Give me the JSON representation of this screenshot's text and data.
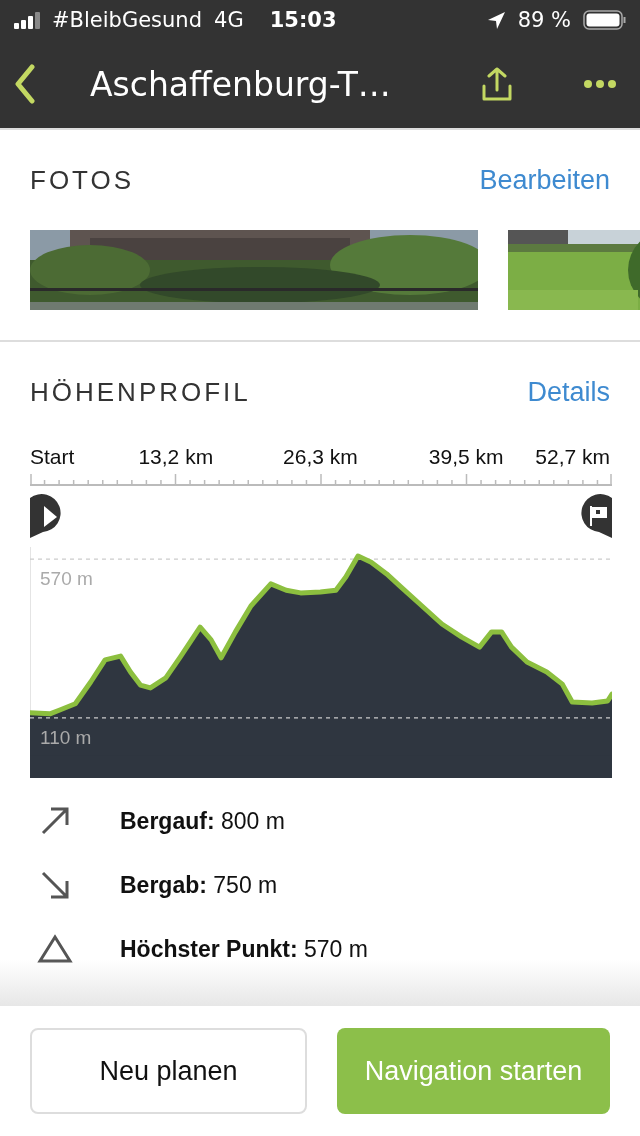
{
  "status_bar": {
    "carrier": "#BleibGesund",
    "network": "4G",
    "time": "15:03",
    "battery": "89 %"
  },
  "nav_bar": {
    "title": "Aschaffenburg-T…"
  },
  "photos": {
    "title": "FOTOS",
    "action": "Bearbeiten"
  },
  "elevation": {
    "title": "HÖHENPROFIL",
    "action": "Details",
    "chart_data": {
      "type": "area",
      "xlim": [
        0,
        52.7
      ],
      "ylim": [
        -64,
        605
      ],
      "xticks": [
        {
          "value": 0,
          "label": "Start"
        },
        {
          "value": 13.2,
          "label": "13,2 km"
        },
        {
          "value": 26.3,
          "label": "26,3 km"
        },
        {
          "value": 39.5,
          "label": "39,5 km"
        },
        {
          "value": 52.7,
          "label": "52,7 km"
        }
      ],
      "yticks": [
        {
          "value": 570,
          "label": "570 m"
        },
        {
          "value": 110,
          "label": "110 m"
        }
      ],
      "x": [
        0,
        1.8,
        2.7,
        4.1,
        5.5,
        6.8,
        8.2,
        9.1,
        10,
        10.9,
        12.3,
        13.6,
        15.4,
        16.4,
        17.3,
        18.6,
        20,
        21.8,
        23.2,
        24.5,
        26.3,
        27.7,
        28.6,
        29.7,
        30.9,
        32.3,
        33.6,
        35.4,
        37.3,
        39.1,
        40.7,
        41.8,
        42.7,
        43.6,
        45,
        46.8,
        48.2,
        49.1,
        50.9,
        52.3,
        52.7
      ],
      "series": [
        {
          "color": "#8cbf3f",
          "values": [
            125,
            122,
            133,
            151,
            214,
            278,
            289,
            243,
            205,
            197,
            226,
            286,
            373,
            336,
            284,
            359,
            434,
            498,
            480,
            472,
            475,
            480,
            518,
            579,
            561,
            527,
            489,
            437,
            382,
            344,
            315,
            359,
            359,
            315,
            272,
            243,
            208,
            156,
            153,
            159,
            179
          ]
        }
      ]
    },
    "stats": [
      {
        "kind": "up",
        "text": "**Bergauf:** 800 m"
      },
      {
        "kind": "down",
        "text": "**Bergab:** 750 m"
      },
      {
        "kind": "peak",
        "text": "**Höchster Punkt:** 570 m"
      }
    ]
  },
  "buttons": [
    {
      "kind": "secondary",
      "label": "Neu planen"
    },
    {
      "kind": "primary",
      "label": "Navigation starten"
    }
  ]
}
